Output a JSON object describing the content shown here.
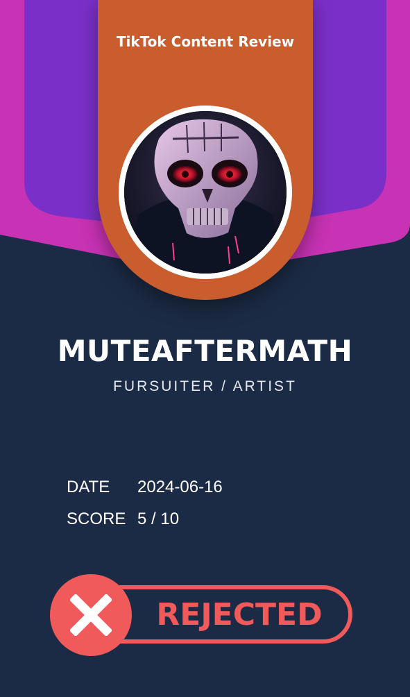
{
  "card": {
    "header_title": "TikTok Content Review",
    "avatar_icon": "skull-mask-avatar-icon",
    "username": "MUTEAFTERMATH",
    "subtitle": "FURSUITER / ARTIST"
  },
  "info": {
    "date_label": "DATE",
    "date_value": "2024-06-16",
    "score_label": "SCORE",
    "score_value": "5 / 10"
  },
  "status": {
    "label": "REJECTED",
    "icon": "close-x-icon"
  },
  "colors": {
    "background": "#1c2b45",
    "magenta": "#c832b4",
    "purple": "#7a30c8",
    "orange": "#c95d2e",
    "reject_red": "#f15a5a"
  }
}
